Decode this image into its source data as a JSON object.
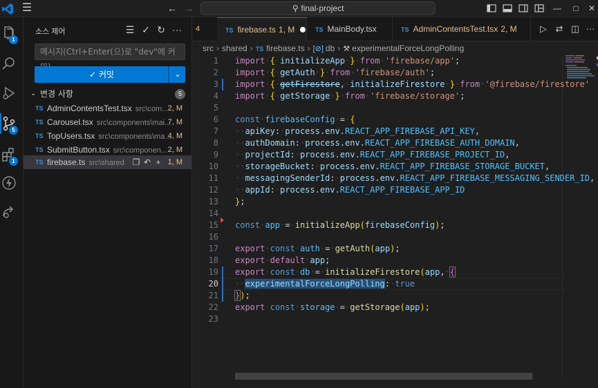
{
  "titlebar": {
    "search_text": "final-project",
    "icons": [
      "vscode-logo-icon",
      "menu-icon",
      "back-arrow-icon",
      "forward-arrow-icon",
      "search-icon",
      "toggle-sidebar-icon",
      "toggle-panel-icon",
      "toggle-secondary-sidebar-icon",
      "customize-layout-icon",
      "minimize-icon",
      "maximize-icon",
      "close-icon"
    ]
  },
  "activitybar": {
    "items": [
      {
        "name": "explorer",
        "badge": "1"
      },
      {
        "name": "search",
        "badge": ""
      },
      {
        "name": "run-debug",
        "badge": ""
      },
      {
        "name": "source-control",
        "badge": "5"
      },
      {
        "name": "extensions",
        "badge": "1"
      },
      {
        "name": "remote",
        "badge": ""
      },
      {
        "name": "live-share",
        "badge": ""
      }
    ]
  },
  "sidebar": {
    "title": "소스 제어",
    "message_placeholder": "메시지(Ctrl+Enter(으)로 \"dev\"에 커밋)",
    "commit_label": "✓ 커밋",
    "section_label": "변경 사항",
    "change_count": "5",
    "files": [
      {
        "name": "AdminContentsTest.tsx",
        "path": "src\\com...",
        "status": "2, M"
      },
      {
        "name": "Carousel.tsx",
        "path": "src\\components\\mai...",
        "status": "7, M"
      },
      {
        "name": "TopUsers.tsx",
        "path": "src\\components\\ma...",
        "status": "4, M"
      },
      {
        "name": "SubmitButton.tsx",
        "path": "src\\componen...",
        "status": "2, M"
      },
      {
        "name": "firebase.ts",
        "path": "src\\shared",
        "status": "1, M"
      }
    ]
  },
  "tabs": {
    "overflow_count": "4",
    "items": [
      {
        "label": "firebase.ts",
        "status": "1, M",
        "color": "#e2c08d"
      },
      {
        "label": "MainBody.tsx",
        "status": "",
        "color": "#cccccc"
      },
      {
        "label": "AdminContentsTest.tsx",
        "status": "2, M",
        "color": "#e2c08d"
      }
    ]
  },
  "breadcrumb": {
    "segments": [
      "src",
      "shared",
      "firebase.ts",
      "db",
      "experimentalForceLongPolling"
    ]
  },
  "editor": {
    "current_line": 20,
    "line_numbers": [
      "1",
      "2",
      "3",
      "4",
      "5",
      "6",
      "7",
      "8",
      "9",
      "10",
      "11",
      "12",
      "13",
      "14",
      "15",
      "16",
      "17",
      "18",
      "19",
      "20",
      "21",
      "22",
      "23"
    ]
  },
  "colors": {
    "accent": "#0078d4",
    "modified": "#e2c08d",
    "ts_badge": "#3d8fd6"
  }
}
